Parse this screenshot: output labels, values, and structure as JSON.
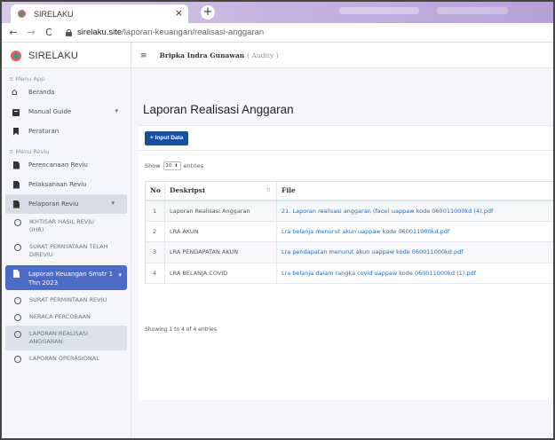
{
  "browser": {
    "tab_title": "SIRELAKU",
    "tab_close": "×",
    "new_tab": "+",
    "url_host": "sirelaku.site",
    "url_path": "/laporan-keuangan/realisasi-anggaran"
  },
  "sidebar": {
    "brand": "SIRELAKU",
    "menu_app_header": "≡ Menu App",
    "menu_app": [
      {
        "label": "Beranda",
        "icon": "home-icon"
      },
      {
        "label": "Manual Guide",
        "icon": "book-icon",
        "has_chevron": true
      },
      {
        "label": "Peraturan",
        "icon": "bookmark-icon"
      }
    ],
    "menu_reviu_header": "≡ Menu Reviu",
    "menu_reviu": [
      {
        "label": "Perencanaan Reviu",
        "icon": "file-icon"
      },
      {
        "label": "Pelaksanaan Reviu",
        "icon": "file-icon"
      },
      {
        "label": "Pelaporan Reviu",
        "icon": "file-icon",
        "has_chevron": true
      }
    ],
    "pelaporan_sub": [
      "IKHTISAR HASIL REVIU (IHR)",
      "SURAT PERNYATAAN TELAH DIREVIU"
    ],
    "active_group": "Laporan Keuangan Smstr 1 Thn 2023",
    "laporan_sub": [
      "SURAT PERMINTAAN REVIU",
      "NERACA PERCOBAAN",
      "LAPORAN REALISASI ANGGARAN",
      "LAPORAN OPERASIONAL"
    ],
    "chevron": "▾"
  },
  "header": {
    "hamburger": "≡",
    "user_name": "Bripka Indra Gunawan",
    "user_role": "( Audity )"
  },
  "main": {
    "page_title": "Laporan Realisasi Anggaran",
    "add_button": "+ Input Data",
    "show_label": "Show",
    "show_value": "10",
    "entries_label": "entries",
    "columns": [
      "No",
      "Deskripsi",
      "File"
    ],
    "sort_glyph": "⇅",
    "rows": [
      {
        "no": "1",
        "desc": "Laporan Realisasi Anggaran",
        "file": "21. Laporan realisasi anggaran (face) uappaw kode 060011000kd (4).pdf"
      },
      {
        "no": "2",
        "desc": "LRA AKUN",
        "file": "Lra belanja menurut akun uappaw kode 060011000kd.pdf"
      },
      {
        "no": "3",
        "desc": "LRA PENDAPATAN AKUN",
        "file": "Lra pendapatan menurut akun uappaw kode 060011000kd.pdf"
      },
      {
        "no": "4",
        "desc": "LRA BELANJA COVID",
        "file": "Lra belanja dalam rangka covid uappaw kode 060011000kd (1).pdf"
      }
    ],
    "info": "Showing 1 to 4 of 4 entries"
  },
  "colors": {
    "primary_button": "#1a4fa0",
    "active_menu": "#4e6bc4",
    "link": "#2b6cb0",
    "tabbar": "#c9b8e2"
  }
}
